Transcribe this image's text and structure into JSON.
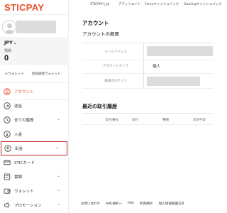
{
  "brand": {
    "logo": "STICPAY",
    "accent": "#e8502a"
  },
  "user": {
    "currency": "JPY",
    "balance_label": "残高",
    "balance": "0"
  },
  "wallet_links": [
    "e-ウォレット",
    "仮想通貨ウォレット"
  ],
  "sidebar": {
    "items": [
      {
        "label": "アカウント",
        "icon": "person-icon",
        "expandable": false,
        "active": true
      },
      {
        "label": "送金",
        "icon": "send-icon",
        "expandable": false,
        "active": false
      },
      {
        "label": "全ての履歴",
        "icon": "history-icon",
        "expandable": true,
        "active": false
      },
      {
        "label": "入金",
        "icon": "deposit-icon",
        "expandable": false,
        "active": false
      },
      {
        "label": "出金",
        "icon": "withdraw-icon",
        "expandable": true,
        "active": false,
        "selected": true
      },
      {
        "label": "STICカード",
        "icon": "card-icon",
        "expandable": false,
        "active": false
      },
      {
        "label": "書類",
        "icon": "document-icon",
        "expandable": true,
        "active": false
      },
      {
        "label": "ウォレット",
        "icon": "wallet-icon",
        "expandable": true,
        "active": false
      },
      {
        "label": "プロモーション",
        "icon": "promotion-icon",
        "expandable": true,
        "active": false
      }
    ]
  },
  "topnav": [
    "STICPAYとは",
    "アフィリエイト",
    "Forexキャッシュバック",
    "Gamingキャッシュバック"
  ],
  "main": {
    "title": "アカウント",
    "subtitle": "アカウントの概要",
    "rows": [
      {
        "label": "メールアドレス",
        "value": ""
      },
      {
        "label": "アカウントタイプ",
        "value": "個人"
      },
      {
        "label": "最後のログイン",
        "value": ""
      }
    ],
    "history": {
      "title": "最近の取引履歴",
      "columns": [
        "取引番号",
        "日付",
        "種類",
        "決済手段"
      ]
    }
  },
  "footer": [
    "お問い合わせ",
    "AML規約ー",
    "FAQ",
    "利用規約",
    "個人情報保護方針"
  ]
}
